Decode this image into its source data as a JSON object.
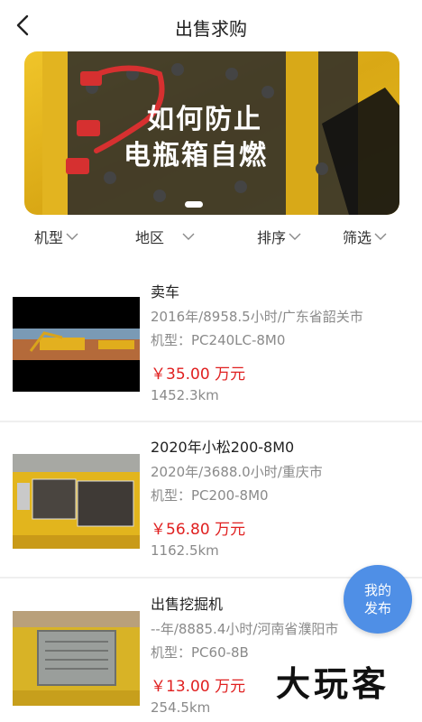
{
  "header": {
    "title": "出售求购",
    "back_icon": "chevron-left-icon"
  },
  "banner": {
    "line1": "如何防止",
    "line2": "电瓶箱自燃"
  },
  "filters": [
    {
      "label": "机型"
    },
    {
      "label": "地区"
    },
    {
      "label": "排序"
    },
    {
      "label": "筛选"
    }
  ],
  "listings": [
    {
      "title": "卖车",
      "meta": "2016年/8958.5小时/广东省韶关市",
      "model": "机型：PC240LC-8M0",
      "price": "￥35.00 万元",
      "distance": "1452.3km"
    },
    {
      "title": "2020年小松200-8M0",
      "meta": "2020年/3688.0小时/重庆市",
      "model": "机型：PC200-8M0",
      "price": "￥56.80 万元",
      "distance": "1162.5km"
    },
    {
      "title": "出售挖掘机",
      "meta": "--年/8885.4小时/河南省濮阳市",
      "model": "机型：PC60-8B",
      "price": "￥13.00 万元",
      "distance": "254.5km"
    }
  ],
  "fab": {
    "line1": "我的",
    "line2": "发布"
  },
  "watermark": "大玩客",
  "colors": {
    "price": "#e02020",
    "fab": "#4f8fe6",
    "banner_yellow": "#e8b820"
  }
}
